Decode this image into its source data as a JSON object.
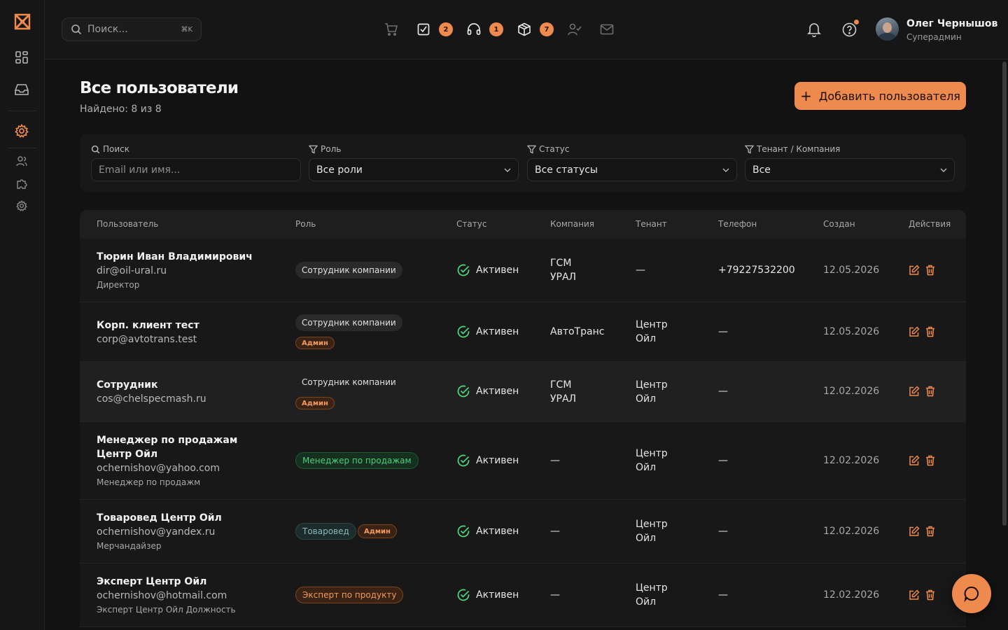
{
  "colors": {
    "accent": "#ee8a4e",
    "success": "#4fcf7a",
    "background": "#121212"
  },
  "search": {
    "placeholder": "Поиск...",
    "shortcut": "⌘K"
  },
  "topbar_badges": {
    "tasks": "2",
    "support": "1",
    "orders": "7"
  },
  "user": {
    "name": "Олег Чернышов",
    "role": "Суперадмин"
  },
  "page": {
    "title": "Все пользователи",
    "found": "Найдено: 8 из 8",
    "add_button": "Добавить пользователя"
  },
  "filters": {
    "search_label": "Поиск",
    "search_placeholder": "Email или имя...",
    "role_label": "Роль",
    "role_value": "Все роли",
    "status_label": "Статус",
    "status_value": "Все статусы",
    "tenant_label": "Тенант / Компания",
    "tenant_value": "Все"
  },
  "table": {
    "headers": {
      "user": "Пользователь",
      "role": "Роль",
      "status": "Статус",
      "company": "Компания",
      "tenant": "Тенант",
      "phone": "Телефон",
      "created": "Создан",
      "actions": "Действия"
    },
    "rows": [
      {
        "name": "Тюрин Иван Владимирович",
        "email": "dir@oil-ural.ru",
        "position": "Директор",
        "role": "Сотрудник компании",
        "status": "Активен",
        "company": "ГСМ УРАЛ",
        "tenant": "—",
        "phone": "+79227532200",
        "created": "12.05.2026"
      },
      {
        "name": "Корп. клиент тест",
        "email": "corp@avtotrans.test",
        "role": "Сотрудник компании",
        "admin": "Админ",
        "status": "Активен",
        "company": "АвтоТранс",
        "tenant": "Центр Ойл",
        "phone": "—",
        "created": "12.05.2026"
      },
      {
        "name": "Сотрудник",
        "email": "cos@chelspecmash.ru",
        "role": "Сотрудник компании",
        "admin": "Админ",
        "status": "Активен",
        "company": "ГСМ УРАЛ",
        "tenant": "Центр Ойл",
        "phone": "—",
        "created": "12.02.2026"
      },
      {
        "name": "Менеджер по продажам Центр Ойл",
        "email": "ochernishov@yahoo.com",
        "position": "Менеджер по продажм",
        "role": "Менеджер по продажам",
        "status": "Активен",
        "company": "—",
        "tenant": "Центр Ойл",
        "phone": "—",
        "created": "12.02.2026"
      },
      {
        "name": "Товаровед Центр Ойл",
        "email": "ochernishov@yandex.ru",
        "position": "Мерчандайзер",
        "role": "Товаровед",
        "admin": "Админ",
        "status": "Активен",
        "company": "—",
        "tenant": "Центр Ойл",
        "phone": "—",
        "created": "12.02.2026"
      },
      {
        "name": "Эксперт Центр Ойл",
        "email": "ochernishov@hotmail.com",
        "position": "Эксперт Центр Ойл Должность",
        "role": "Эксперт по продукту",
        "status": "Активен",
        "company": "—",
        "tenant": "Центр Ойл",
        "phone": "—",
        "created": "12.02.2026"
      }
    ]
  }
}
